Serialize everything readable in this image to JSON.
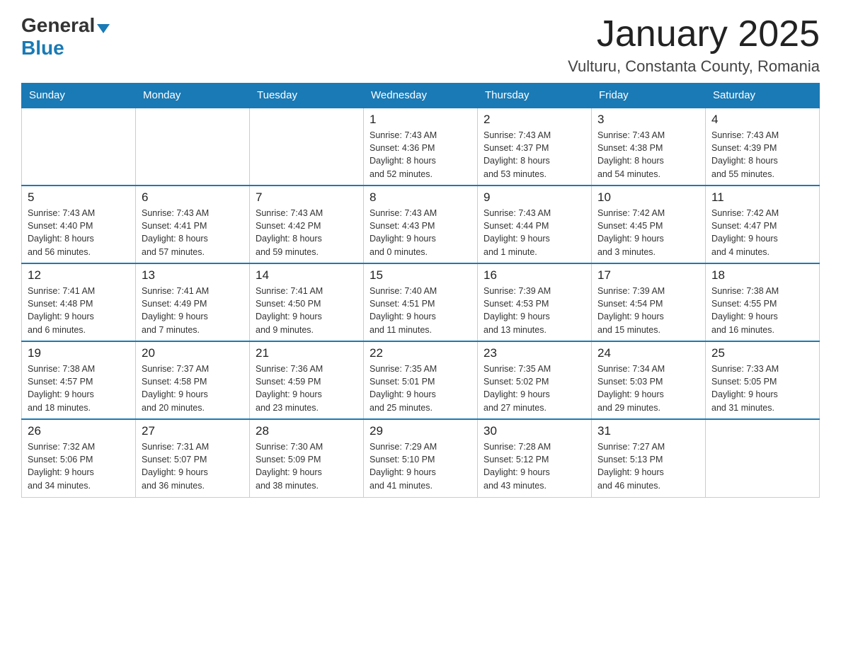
{
  "logo": {
    "general": "General",
    "blue": "Blue",
    "arrow": "▼"
  },
  "header": {
    "month_year": "January 2025",
    "location": "Vulturu, Constanta County, Romania"
  },
  "weekdays": [
    "Sunday",
    "Monday",
    "Tuesday",
    "Wednesday",
    "Thursday",
    "Friday",
    "Saturday"
  ],
  "weeks": [
    [
      {
        "day": "",
        "info": ""
      },
      {
        "day": "",
        "info": ""
      },
      {
        "day": "",
        "info": ""
      },
      {
        "day": "1",
        "info": "Sunrise: 7:43 AM\nSunset: 4:36 PM\nDaylight: 8 hours\nand 52 minutes."
      },
      {
        "day": "2",
        "info": "Sunrise: 7:43 AM\nSunset: 4:37 PM\nDaylight: 8 hours\nand 53 minutes."
      },
      {
        "day": "3",
        "info": "Sunrise: 7:43 AM\nSunset: 4:38 PM\nDaylight: 8 hours\nand 54 minutes."
      },
      {
        "day": "4",
        "info": "Sunrise: 7:43 AM\nSunset: 4:39 PM\nDaylight: 8 hours\nand 55 minutes."
      }
    ],
    [
      {
        "day": "5",
        "info": "Sunrise: 7:43 AM\nSunset: 4:40 PM\nDaylight: 8 hours\nand 56 minutes."
      },
      {
        "day": "6",
        "info": "Sunrise: 7:43 AM\nSunset: 4:41 PM\nDaylight: 8 hours\nand 57 minutes."
      },
      {
        "day": "7",
        "info": "Sunrise: 7:43 AM\nSunset: 4:42 PM\nDaylight: 8 hours\nand 59 minutes."
      },
      {
        "day": "8",
        "info": "Sunrise: 7:43 AM\nSunset: 4:43 PM\nDaylight: 9 hours\nand 0 minutes."
      },
      {
        "day": "9",
        "info": "Sunrise: 7:43 AM\nSunset: 4:44 PM\nDaylight: 9 hours\nand 1 minute."
      },
      {
        "day": "10",
        "info": "Sunrise: 7:42 AM\nSunset: 4:45 PM\nDaylight: 9 hours\nand 3 minutes."
      },
      {
        "day": "11",
        "info": "Sunrise: 7:42 AM\nSunset: 4:47 PM\nDaylight: 9 hours\nand 4 minutes."
      }
    ],
    [
      {
        "day": "12",
        "info": "Sunrise: 7:41 AM\nSunset: 4:48 PM\nDaylight: 9 hours\nand 6 minutes."
      },
      {
        "day": "13",
        "info": "Sunrise: 7:41 AM\nSunset: 4:49 PM\nDaylight: 9 hours\nand 7 minutes."
      },
      {
        "day": "14",
        "info": "Sunrise: 7:41 AM\nSunset: 4:50 PM\nDaylight: 9 hours\nand 9 minutes."
      },
      {
        "day": "15",
        "info": "Sunrise: 7:40 AM\nSunset: 4:51 PM\nDaylight: 9 hours\nand 11 minutes."
      },
      {
        "day": "16",
        "info": "Sunrise: 7:39 AM\nSunset: 4:53 PM\nDaylight: 9 hours\nand 13 minutes."
      },
      {
        "day": "17",
        "info": "Sunrise: 7:39 AM\nSunset: 4:54 PM\nDaylight: 9 hours\nand 15 minutes."
      },
      {
        "day": "18",
        "info": "Sunrise: 7:38 AM\nSunset: 4:55 PM\nDaylight: 9 hours\nand 16 minutes."
      }
    ],
    [
      {
        "day": "19",
        "info": "Sunrise: 7:38 AM\nSunset: 4:57 PM\nDaylight: 9 hours\nand 18 minutes."
      },
      {
        "day": "20",
        "info": "Sunrise: 7:37 AM\nSunset: 4:58 PM\nDaylight: 9 hours\nand 20 minutes."
      },
      {
        "day": "21",
        "info": "Sunrise: 7:36 AM\nSunset: 4:59 PM\nDaylight: 9 hours\nand 23 minutes."
      },
      {
        "day": "22",
        "info": "Sunrise: 7:35 AM\nSunset: 5:01 PM\nDaylight: 9 hours\nand 25 minutes."
      },
      {
        "day": "23",
        "info": "Sunrise: 7:35 AM\nSunset: 5:02 PM\nDaylight: 9 hours\nand 27 minutes."
      },
      {
        "day": "24",
        "info": "Sunrise: 7:34 AM\nSunset: 5:03 PM\nDaylight: 9 hours\nand 29 minutes."
      },
      {
        "day": "25",
        "info": "Sunrise: 7:33 AM\nSunset: 5:05 PM\nDaylight: 9 hours\nand 31 minutes."
      }
    ],
    [
      {
        "day": "26",
        "info": "Sunrise: 7:32 AM\nSunset: 5:06 PM\nDaylight: 9 hours\nand 34 minutes."
      },
      {
        "day": "27",
        "info": "Sunrise: 7:31 AM\nSunset: 5:07 PM\nDaylight: 9 hours\nand 36 minutes."
      },
      {
        "day": "28",
        "info": "Sunrise: 7:30 AM\nSunset: 5:09 PM\nDaylight: 9 hours\nand 38 minutes."
      },
      {
        "day": "29",
        "info": "Sunrise: 7:29 AM\nSunset: 5:10 PM\nDaylight: 9 hours\nand 41 minutes."
      },
      {
        "day": "30",
        "info": "Sunrise: 7:28 AM\nSunset: 5:12 PM\nDaylight: 9 hours\nand 43 minutes."
      },
      {
        "day": "31",
        "info": "Sunrise: 7:27 AM\nSunset: 5:13 PM\nDaylight: 9 hours\nand 46 minutes."
      },
      {
        "day": "",
        "info": ""
      }
    ]
  ]
}
